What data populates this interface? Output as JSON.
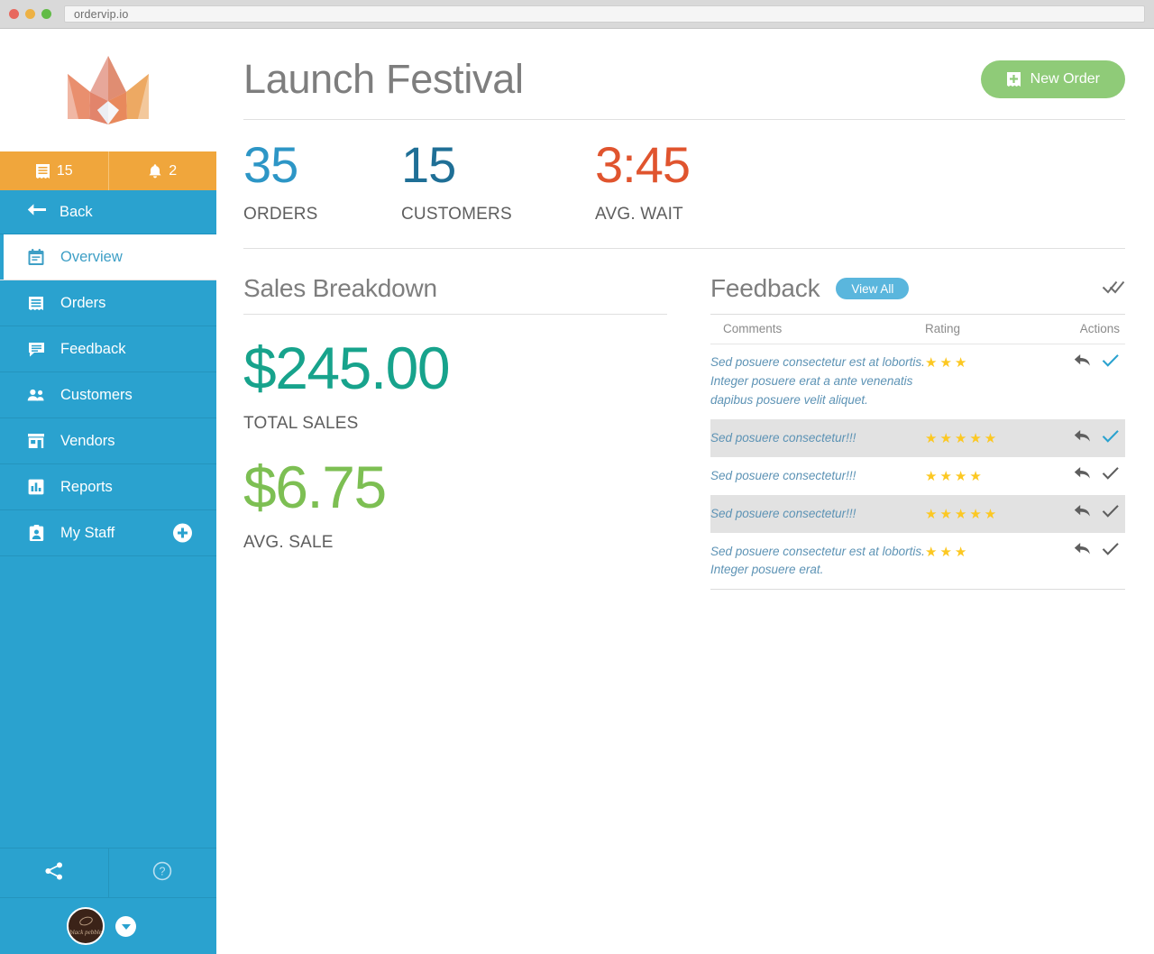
{
  "browser": {
    "url": "ordervip.io",
    "traffic_lights": [
      "close-red",
      "minimize-yellow",
      "maximize-green"
    ]
  },
  "sidebar": {
    "logo": "crown-logo",
    "counters": [
      {
        "icon": "receipt-icon",
        "value": "15",
        "name": "orders-counter"
      },
      {
        "icon": "bell-icon",
        "value": "2",
        "name": "notifications-counter"
      }
    ],
    "back_label": "Back",
    "back_icon": "arrow-left-icon",
    "items": [
      {
        "label": "Overview",
        "icon": "calendar-icon",
        "active": true
      },
      {
        "label": "Orders",
        "icon": "receipt-icon",
        "active": false
      },
      {
        "label": "Feedback",
        "icon": "comment-icon",
        "active": false
      },
      {
        "label": "Customers",
        "icon": "people-icon",
        "active": false
      },
      {
        "label": "Vendors",
        "icon": "store-icon",
        "active": false
      },
      {
        "label": "Reports",
        "icon": "bar-chart-icon",
        "active": false
      },
      {
        "label": "My Staff",
        "icon": "id-badge-icon",
        "active": false,
        "add_button": true
      }
    ],
    "tools": [
      {
        "icon": "share-icon",
        "name": "share-button"
      },
      {
        "icon": "help-icon",
        "name": "help-button"
      }
    ],
    "user": {
      "avatar_text": "black pebble",
      "caret_icon": "chevron-down-icon"
    }
  },
  "header": {
    "title": "Launch Festival",
    "new_order_label": "New Order",
    "new_order_icon": "add-order-icon"
  },
  "stats": [
    {
      "value": "35",
      "label": "ORDERS",
      "color": "#2d96c6"
    },
    {
      "value": "15",
      "label": "CUSTOMERS",
      "color": "#1f6f96"
    },
    {
      "value": "3:45",
      "label": "AVG. WAIT",
      "color": "#e0542e"
    }
  ],
  "sales": {
    "title": "Sales Breakdown",
    "total_value": "$245.00",
    "total_label": "TOTAL SALES",
    "total_color": "#17a38c",
    "avg_value": "$6.75",
    "avg_label": "AVG. SALE",
    "avg_color": "#7dbf53"
  },
  "feedback": {
    "title": "Feedback",
    "view_all_label": "View All",
    "mark_all_icon": "double-check-icon",
    "columns": [
      "Comments",
      "Rating",
      "Actions"
    ],
    "rows": [
      {
        "comment": "Sed posuere consectetur est at lobortis. Integer posuere erat a ante venenatis dapibus posuere velit aliquet.",
        "rating": 3,
        "alt": false,
        "reply_icon": "reply-arrow-icon",
        "check_icon": "check-icon",
        "check_active": true
      },
      {
        "comment": "Sed posuere consectetur!!!",
        "rating": 5,
        "alt": true,
        "reply_icon": "reply-arrow-icon",
        "check_icon": "check-icon",
        "check_active": true
      },
      {
        "comment": "Sed posuere consectetur!!!",
        "rating": 4,
        "alt": false,
        "reply_icon": "reply-arrow-icon",
        "check_icon": "check-icon",
        "check_active": false
      },
      {
        "comment": "Sed posuere consectetur!!!",
        "rating": 5,
        "alt": true,
        "reply_icon": "reply-arrow-icon",
        "check_icon": "check-icon",
        "check_active": false
      },
      {
        "comment": "Sed posuere consectetur est at lobortis. Integer posuere erat.",
        "rating": 3,
        "alt": false,
        "reply_icon": "reply-arrow-icon",
        "check_icon": "check-icon",
        "check_active": false
      }
    ]
  },
  "colors": {
    "sidebar_blue": "#2aa2cf",
    "counter_orange": "#f0a63c",
    "accent_green": "#8fcb78",
    "star_yellow": "#fcc822",
    "comment_blue": "#5d93b5",
    "check_blue": "#2aa2cf"
  }
}
